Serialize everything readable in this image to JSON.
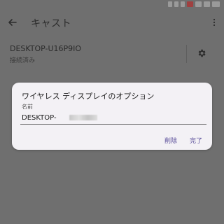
{
  "toolbar": {
    "back_icon": "arrow-left",
    "title": "キャスト",
    "more_icon": "more-vertical"
  },
  "device": {
    "name": "DESKTOP-U16P9IO",
    "status": "接続済み",
    "settings_icon": "gear"
  },
  "dialog": {
    "title": "ワイヤレス ディスプレイのオプション",
    "name_label": "名前",
    "name_value": "DESKTOP-",
    "delete_label": "削除",
    "done_label": "完了"
  },
  "colors": {
    "scrim": "#6f6f6f",
    "dialog_bg": "#f3f1f5",
    "accent": "#5a4e9a"
  }
}
